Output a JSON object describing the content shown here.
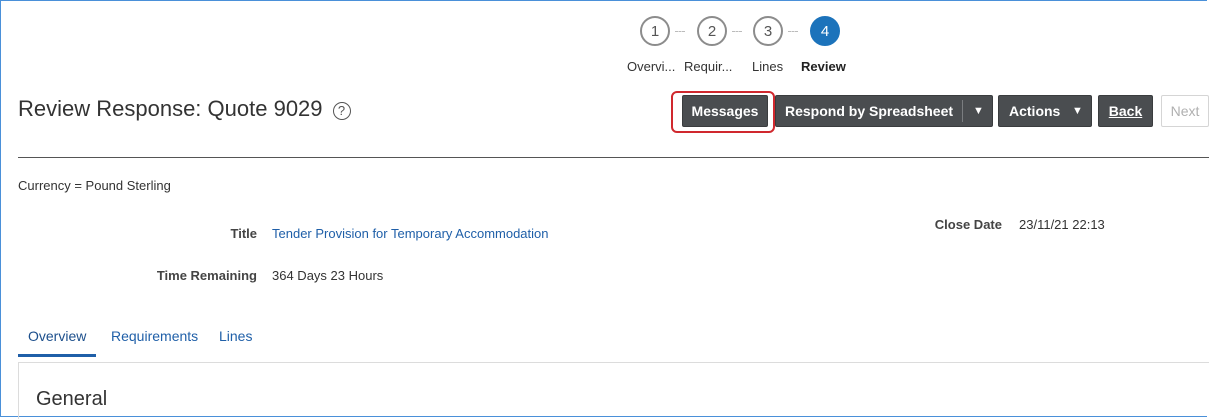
{
  "train": {
    "stops": [
      {
        "number": "1",
        "label": "Overvi..."
      },
      {
        "number": "2",
        "label": "Requir..."
      },
      {
        "number": "3",
        "label": "Lines"
      },
      {
        "number": "4",
        "label": "Review"
      }
    ]
  },
  "header": {
    "title": "Review Response: Quote 9029",
    "help_icon": "question-circle-icon"
  },
  "toolbar": {
    "messages_label": "Messages",
    "respond_label": "Respond by Spreadsheet",
    "actions_label": "Actions",
    "back_label": "Back",
    "next_label": "Next",
    "caret_glyph": "▼",
    "highlight_color": "#d0282e"
  },
  "details": {
    "currency": "Currency = Pound Sterling",
    "title_label": "Title",
    "title_value": "Tender Provision for Temporary Accommodation",
    "time_label": "Time Remaining",
    "time_value": "364 Days 23 Hours",
    "close_label": "Close Date",
    "close_value": "23/11/21 22:13"
  },
  "tabs": [
    {
      "label": "Overview"
    },
    {
      "label": "Requirements"
    },
    {
      "label": "Lines"
    }
  ],
  "section": {
    "title": "General"
  },
  "colors": {
    "accent": "#1c73bb",
    "link": "#1f5fa8",
    "button_bg": "#4a4d50"
  }
}
